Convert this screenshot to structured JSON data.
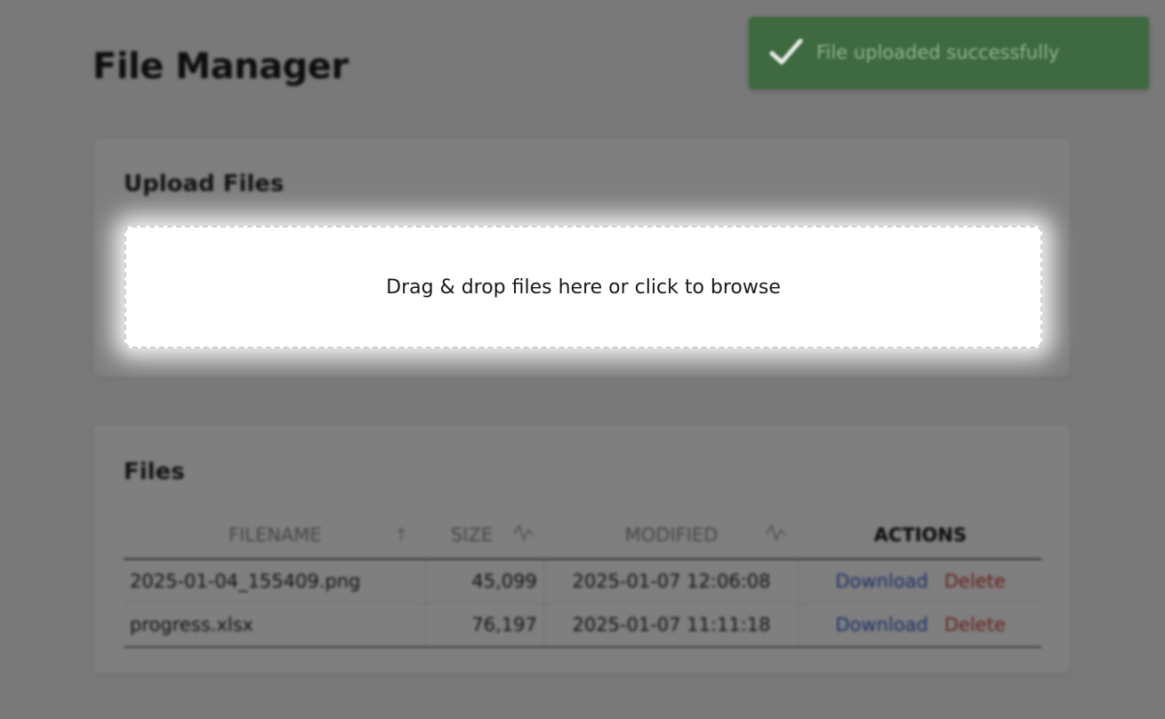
{
  "page": {
    "title": "File Manager"
  },
  "toast": {
    "message": "File uploaded successfully",
    "icon": "check-icon",
    "color": "#3f6a3f"
  },
  "upload": {
    "title": "Upload Files",
    "dropzone_text": "Drag & drop files here or click to browse"
  },
  "files": {
    "title": "Files",
    "columns": {
      "filename": "FILENAME",
      "size": "SIZE",
      "modified": "MODIFIED",
      "actions": "ACTIONS"
    },
    "sort_icons": {
      "filename": "arrow-up-icon",
      "size": "sort-icon",
      "modified": "sort-icon"
    },
    "rows": [
      {
        "filename": "2025-01-04_155409.png",
        "size": "45,099",
        "modified": "2025-01-07 12:06:08",
        "download_label": "Download",
        "delete_label": "Delete"
      },
      {
        "filename": "progress.xlsx",
        "size": "76,197",
        "modified": "2025-01-07 11:11:18",
        "download_label": "Download",
        "delete_label": "Delete"
      }
    ]
  },
  "colors": {
    "link": "#3b5ccc",
    "danger": "#d23b3b",
    "success": "#3f6a3f"
  }
}
